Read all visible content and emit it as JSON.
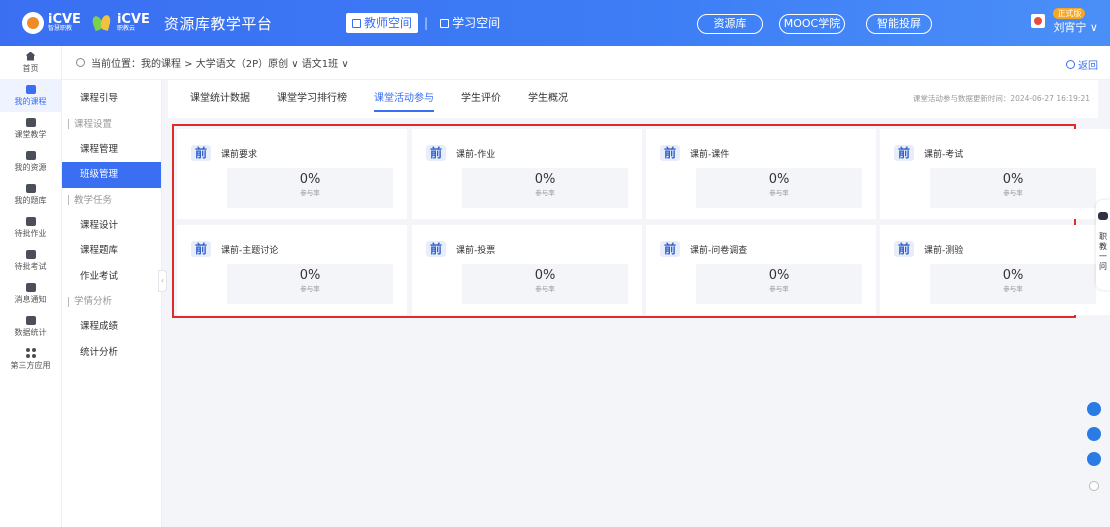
{
  "header": {
    "logo1_main": "iCVE",
    "logo1_sub": "智慧职教",
    "logo2_main": "iCVE",
    "logo2_sub": "职教云",
    "app_title": "资源库教学平台",
    "space_teacher": "教师空间",
    "space_student": "学习空间",
    "pill_resource": "资源库",
    "pill_mooc": "MOOC学院",
    "pill_screen": "智能投屏",
    "user_badge": "正式版",
    "user_name": "刘宵宁 ∨"
  },
  "leftrail": [
    {
      "label": "首页",
      "icon": "home-icon"
    },
    {
      "label": "我的课程",
      "icon": "courses-icon"
    },
    {
      "label": "课堂教学",
      "icon": "classroom-icon"
    },
    {
      "label": "我的资源",
      "icon": "resources-icon"
    },
    {
      "label": "我的题库",
      "icon": "question-bank-icon"
    },
    {
      "label": "待批作业",
      "icon": "homework-icon"
    },
    {
      "label": "待批考试",
      "icon": "exam-icon"
    },
    {
      "label": "消息通知",
      "icon": "message-icon"
    },
    {
      "label": "数据统计",
      "icon": "stats-icon"
    },
    {
      "label": "第三方应用",
      "icon": "apps-icon"
    }
  ],
  "breadcrumb": {
    "text": "当前位置：我的课程 > 大学语文（2P）原创 ∨  语文1班 ∨",
    "back": "返回"
  },
  "subnav": {
    "guide": "课程引导",
    "group_settings": "课程设置",
    "course_manage": "课程管理",
    "class_manage": "班级管理",
    "group_tasks": "教学任务",
    "course_design": "课程设计",
    "course_bank": "课程题库",
    "homework_exam": "作业考试",
    "group_analysis": "学情分析",
    "course_scores": "课程成绩",
    "stats_analysis": "统计分析"
  },
  "tabs": {
    "items": [
      "课堂统计数据",
      "课堂学习排行榜",
      "课堂活动参与",
      "学生评价",
      "学生概况"
    ],
    "update_time": "课堂活动参与数据更新时间：2024-06-27 16:19:21"
  },
  "cards": [
    {
      "badge": "前",
      "title": "课前要求",
      "value": "0%",
      "label": "参与率"
    },
    {
      "badge": "前",
      "title": "课前-作业",
      "value": "0%",
      "label": "参与率"
    },
    {
      "badge": "前",
      "title": "课前-课件",
      "value": "0%",
      "label": "参与率"
    },
    {
      "badge": "前",
      "title": "课前-考试",
      "value": "0%",
      "label": "参与率"
    },
    {
      "badge": "前",
      "title": "课前-主题讨论",
      "value": "0%",
      "label": "参与率"
    },
    {
      "badge": "前",
      "title": "课前-投票",
      "value": "0%",
      "label": "参与率"
    },
    {
      "badge": "前",
      "title": "课前-问卷调查",
      "value": "0%",
      "label": "参与率"
    },
    {
      "badge": "前",
      "title": "课前-测验",
      "value": "0%",
      "label": "参与率"
    }
  ],
  "right_side": {
    "text": "职教一问"
  },
  "colors": {
    "accent": "#3a6ff2",
    "highlight_border": "#e02b2b"
  }
}
